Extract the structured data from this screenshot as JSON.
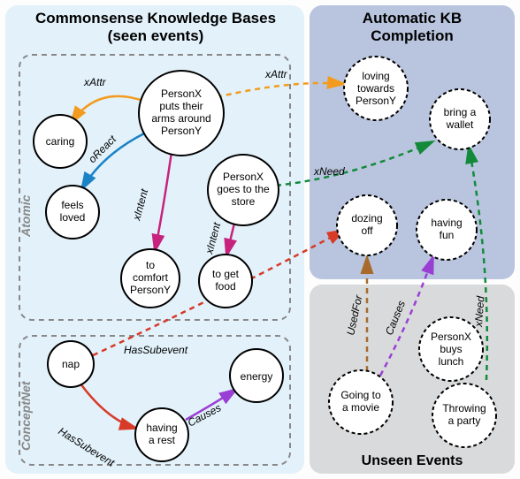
{
  "panels": {
    "kb_title_l1": "Commonsense Knowledge Bases",
    "kb_title_l2": "(seen events)",
    "completion_title_l1": "Automatic KB",
    "completion_title_l2": "Completion",
    "unseen_title": "Unseen Events"
  },
  "groups": {
    "atomic": "Atomic",
    "conceptnet": "ConceptNet"
  },
  "relations": {
    "xattr": "xAttr",
    "oreact": "oReact",
    "xintent": "xIntent",
    "xneed": "xNeed",
    "hassubevent": "HasSubevent",
    "causes": "Causes",
    "usedfor": "UsedFor"
  },
  "nodes": {
    "hug_l1": "PersonX",
    "hug_l2": "puts their",
    "hug_l3": "arms around",
    "hug_l4": "PersonY",
    "caring": "caring",
    "feels_l1": "feels",
    "feels_l2": "loved",
    "comfort_l1": "to",
    "comfort_l2": "comfort",
    "comfort_l3": "PersonY",
    "store_l1": "PersonX",
    "store_l2": "goes to the",
    "store_l3": "store",
    "getfood_l1": "to get",
    "getfood_l2": "food",
    "nap": "nap",
    "rest_l1": "having",
    "rest_l2": "a rest",
    "energy": "energy",
    "loving_l1": "loving",
    "loving_l2": "towards",
    "loving_l3": "PersonY",
    "wallet_l1": "bring a",
    "wallet_l2": "wallet",
    "dozing_l1": "dozing",
    "dozing_l2": "off",
    "fun_l1": "having",
    "fun_l2": "fun",
    "movie_l1": "Going to",
    "movie_l2": "a movie",
    "lunch_l1": "PersonX",
    "lunch_l2": "buys",
    "lunch_l3": "lunch",
    "party_l1": "Throwing",
    "party_l2": "a party"
  },
  "colors": {
    "kb_bg": "#e2f1fa",
    "comp_bg": "#b9c5de",
    "unseen_bg": "#d9dadc",
    "orange": "#f39b1e",
    "blue": "#1b82c6",
    "magenta": "#c7237e",
    "green": "#128a3a",
    "red": "#d83a28",
    "purple": "#9a3fd4",
    "brown": "#a76a2b"
  }
}
